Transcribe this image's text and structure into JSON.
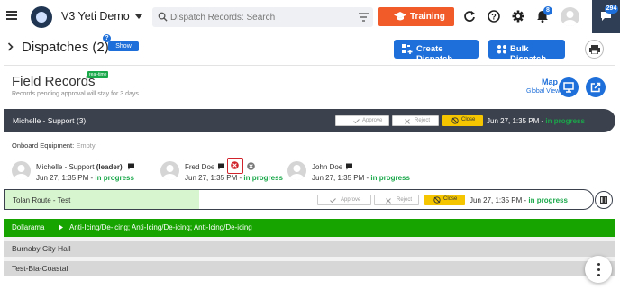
{
  "topbar": {
    "app_title": "V3 Yeti Demo",
    "search_placeholder": "Dispatch Records: Search",
    "training_label": "Training",
    "notification_count": "8",
    "message_count": "294",
    "training_color": "#f15a29",
    "dark_color": "#2f3e54"
  },
  "header": {
    "title": "Dispatches (2)",
    "show_label": "Show",
    "help_label": "?",
    "create_label": "Create Dispatch",
    "bulk_label": "Bulk Dispatch",
    "accent": "#1e6fd9"
  },
  "field_records": {
    "title": "Field Records",
    "badge": "real-time",
    "subtitle": "Records pending approval will stay for 3 days.",
    "map_label": "Map",
    "global_view_label": "Global View"
  },
  "group": {
    "name": "Michelle - Support (3)",
    "approve_label": "Approve",
    "reject_label": "Reject",
    "close_label": "Close",
    "time": "Jun 27, 1:35 PM -",
    "status": "in progress",
    "onboard_label": "Onboard Equipment:",
    "onboard_value": "Empty",
    "members": [
      {
        "name": "Michelle - Support",
        "role": "(leader)",
        "time": "Jun 27, 1:35 PM -",
        "status": "in progress"
      },
      {
        "name": "Fred Doe",
        "role": "",
        "time": "Jun 27, 1:35 PM -",
        "status": "in progress"
      },
      {
        "name": "John Doe",
        "role": "",
        "time": "Jun 27, 1:35 PM -",
        "status": "in progress"
      }
    ]
  },
  "tolan": {
    "name": "Tolan Route - Test",
    "approve_label": "Approve",
    "reject_label": "Reject",
    "close_label": "Close",
    "time": "Jun 27, 1:35 PM -",
    "status": "in progress"
  },
  "rows": {
    "dollarama_name": "Dollarama",
    "dollarama_services": "Anti-Icing/De-icing; Anti-Icing/De-icing; Anti-Icing/De-icing",
    "burnaby": "Burnaby City Hall",
    "bia": "Test-Bia-Coastal",
    "green_color": "#17a300"
  }
}
